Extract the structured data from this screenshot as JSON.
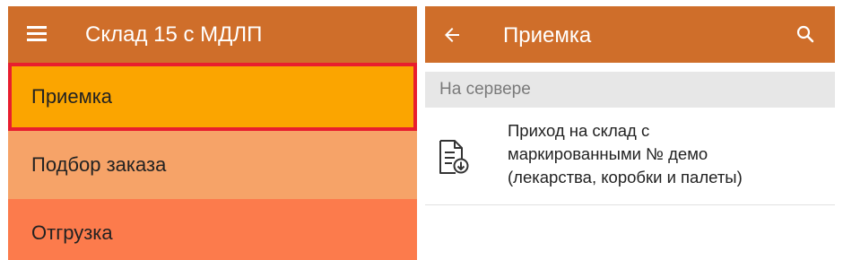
{
  "left_screen": {
    "app_bar": {
      "menu_icon": "hamburger-menu-icon",
      "title": "Склад 15 с МДЛП"
    },
    "menu_items": [
      {
        "label": "Приемка",
        "selected": true,
        "background": "#fba500",
        "highlight_border": "#e81e2e"
      },
      {
        "label": "Подбор заказа",
        "selected": false,
        "background": "#f6a368"
      },
      {
        "label": "Отгрузка",
        "selected": false,
        "background": "#fc7b4c"
      }
    ]
  },
  "right_screen": {
    "app_bar": {
      "back_icon": "back-arrow-icon",
      "title": "Приемка",
      "search_icon": "search-icon"
    },
    "section_header": "На сервере",
    "documents": [
      {
        "icon": "document-download-icon",
        "title_lines": [
          "Приход на склад с",
          "маркированными № демо",
          "(лекарства, коробки и палеты)"
        ]
      }
    ]
  },
  "colors": {
    "app_bar": "#cf6e2a",
    "app_bar_text": "#ffffff",
    "section_header_bg": "#e7e7e7"
  }
}
